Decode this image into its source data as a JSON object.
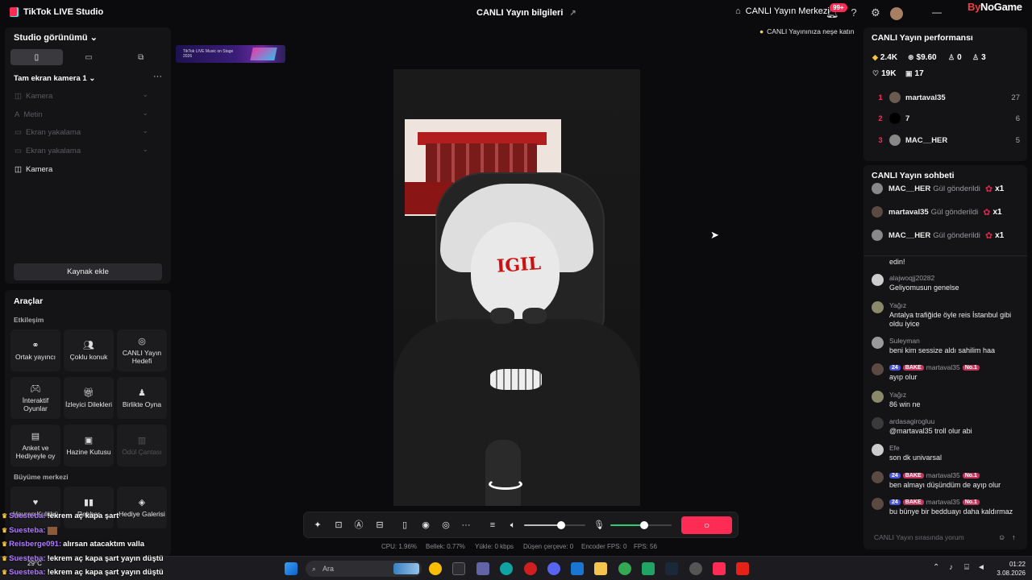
{
  "titlebar": {
    "app_name": "TikTok LIVE Studio",
    "live_info": "CANLI Yayın bilgileri",
    "live_center": "CANLI Yayın Merkezi",
    "notification_badge": "99+",
    "brand_a": "By",
    "brand_b": "NoGame"
  },
  "studio": {
    "title": "Studio görünümü",
    "scene": "Tam ekran kamera 1",
    "sources": [
      "Kamera",
      "Metin",
      "Ekran yakalama",
      "Ekran yakalama",
      "Kamera"
    ],
    "add_source": "Kaynak ekle"
  },
  "tools": {
    "title": "Araçlar",
    "section_engage": "Etkileşim",
    "section_growth": "Büyüme merkezi",
    "items": [
      {
        "label": "Ortak yayıncı",
        "icon": "link-icon"
      },
      {
        "label": "Çoklu konuk",
        "icon": "users-icon"
      },
      {
        "label": "CANLI Yayın Hedefi",
        "icon": "target-icon"
      },
      {
        "label": "İnteraktif Oyunlar",
        "icon": "gamepad-icon"
      },
      {
        "label": "İzleyici Dilekleri",
        "icon": "gift-icon"
      },
      {
        "label": "Birlikte Oyna",
        "icon": "play-together-icon"
      },
      {
        "label": "Anket ve Hediyeyle oy",
        "icon": "poll-icon"
      },
      {
        "label": "Hazine Kutusu",
        "icon": "treasure-icon"
      },
      {
        "label": "Ödül Çantası",
        "icon": "bag-icon"
      },
      {
        "label": "Hayran Kulübü",
        "icon": "heart-icon"
      },
      {
        "label": "Rehber",
        "icon": "guide-icon"
      },
      {
        "label": "Hediye Galerisi",
        "icon": "gallery-icon"
      }
    ]
  },
  "preview": {
    "banner_text": "TikTok LIVE Music on Stage 2026",
    "hint": "CANLI Yayınınıza neşe katın",
    "mask_text": "IGIL"
  },
  "controls": {
    "go_live_icon": "○",
    "speaker_level": 0.6,
    "mic_level": 0.55
  },
  "stats": [
    "CPU: 1.96%",
    "Bellek: 0.77%",
    "Yükle: 0 kbps",
    "Düşen çerçeve: 0",
    "Encoder FPS: 0",
    "FPS: 56"
  ],
  "performance": {
    "title": "CANLI Yayın performansı",
    "coins": "2.4K",
    "dollars": "$9.60",
    "followers": "0",
    "shares": "3",
    "likes": "19K",
    "gifts": "17",
    "ranking": [
      {
        "rank": "1",
        "name": "martaval35",
        "value": "27"
      },
      {
        "rank": "2",
        "name": "7",
        "value": "6"
      },
      {
        "rank": "3",
        "name": "MAC__HER",
        "value": "5"
      }
    ]
  },
  "chat": {
    "title": "CANLI Yayın sohbeti",
    "gifts": [
      {
        "name": "MAC__HER",
        "text": "Gül gönderildi",
        "count": "x1"
      },
      {
        "name": "martaval35",
        "text": "Gül gönderildi",
        "count": "x1"
      },
      {
        "name": "MAC__HER",
        "text": "Gül gönderildi",
        "count": "x1"
      }
    ],
    "messages": [
      {
        "name": "",
        "text": "edin!"
      },
      {
        "name": "alajwoqjj20282",
        "text": "Geliyomusun genelse"
      },
      {
        "name": "Yağız",
        "text": "Antalya trafiğide öyle reis İstanbul gibi oldu iyice"
      },
      {
        "name": "Suleyman",
        "text": "beni kim sessize aldı sahilim haa"
      },
      {
        "name": "martaval35",
        "level": "24",
        "fan": "BAKE",
        "tag": "No.1",
        "text": "ayıp olur"
      },
      {
        "name": "Yağız",
        "text": "86 win ne"
      },
      {
        "name": "ardasagirogluu",
        "text": "@martaval35 troll olur abi"
      },
      {
        "name": "Efe",
        "text": "son dk univarsal"
      },
      {
        "name": "martaval35",
        "level": "24",
        "fan": "BAKE",
        "tag": "No.1",
        "text": "ben almayı düşündüm de ayıp olur"
      },
      {
        "name": "martaval35",
        "level": "24",
        "fan": "BAKE",
        "tag": "No.1",
        "text": "bu bünye bir bedduayı daha kaldırmaz"
      }
    ],
    "placeholder": "CANLI Yayın sırasında yorum"
  },
  "overlay_chat": [
    {
      "name": "Suesteba:",
      "text": "!ekrem aç kapa şart"
    },
    {
      "name": "Suesteba:",
      "text": ""
    },
    {
      "name": "Reisberge091:",
      "text": "alırsan atacaktım valla"
    },
    {
      "name": "Suesteba:",
      "text": "!ekrem aç kapa şart yayın düştü"
    },
    {
      "name": "Suesteba:",
      "text": "!ekrem aç kapa şart yayın düştü"
    }
  ],
  "taskbar": {
    "search": "Ara",
    "weather": "29°C",
    "time": "01:22",
    "date": "3.08.2026"
  },
  "colors": {
    "accent": "#fe2c55",
    "panel": "#141416",
    "background": "#0b0b0d"
  }
}
